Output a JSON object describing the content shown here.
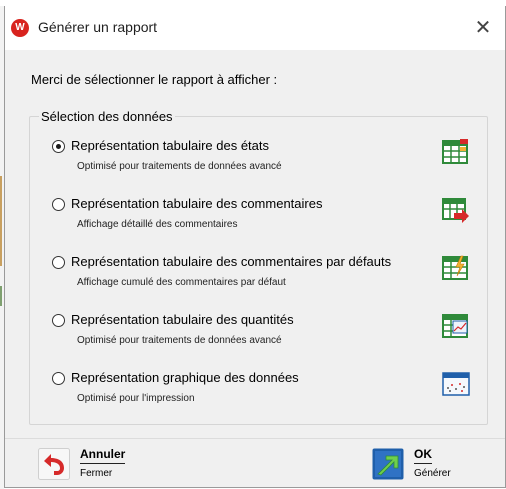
{
  "dialog": {
    "title": "Générer un rapport",
    "app_icon_glyph": "W",
    "close_glyph": "✕",
    "prompt": "Merci de sélectionner le rapport à afficher :"
  },
  "group": {
    "label": "Sélection des données",
    "options": [
      {
        "title": "Représentation tabulaire des états",
        "subtitle": "Optimisé pour traitements de données avancé",
        "checked": true,
        "icon": "table-status-icon"
      },
      {
        "title": "Représentation tabulaire des commentaires",
        "subtitle": "Affichage détaillé des commentaires",
        "checked": false,
        "icon": "table-comments-icon"
      },
      {
        "title": "Représentation tabulaire des commentaires par défauts",
        "subtitle": "Affichage cumulé des commentaires par défaut",
        "checked": false,
        "icon": "table-defaults-icon"
      },
      {
        "title": "Représentation tabulaire des quantités",
        "subtitle": "Optimisé pour traitements de données avancé",
        "checked": false,
        "icon": "table-quantities-icon"
      },
      {
        "title": "Représentation graphique des données",
        "subtitle": "Optimisé pour l'impression",
        "checked": false,
        "icon": "graph-icon"
      }
    ]
  },
  "actions": {
    "cancel": {
      "label": "Annuler",
      "sub": "Fermer",
      "icon": "undo-arrow-icon"
    },
    "ok": {
      "label": "OK",
      "sub": "Générer",
      "icon": "ok-arrow-icon"
    }
  },
  "colors": {
    "app_icon": "#d8231e",
    "table_green": "#2f8a3a",
    "accent_red": "#d62a2a",
    "ok_blue": "#1f5faa"
  }
}
